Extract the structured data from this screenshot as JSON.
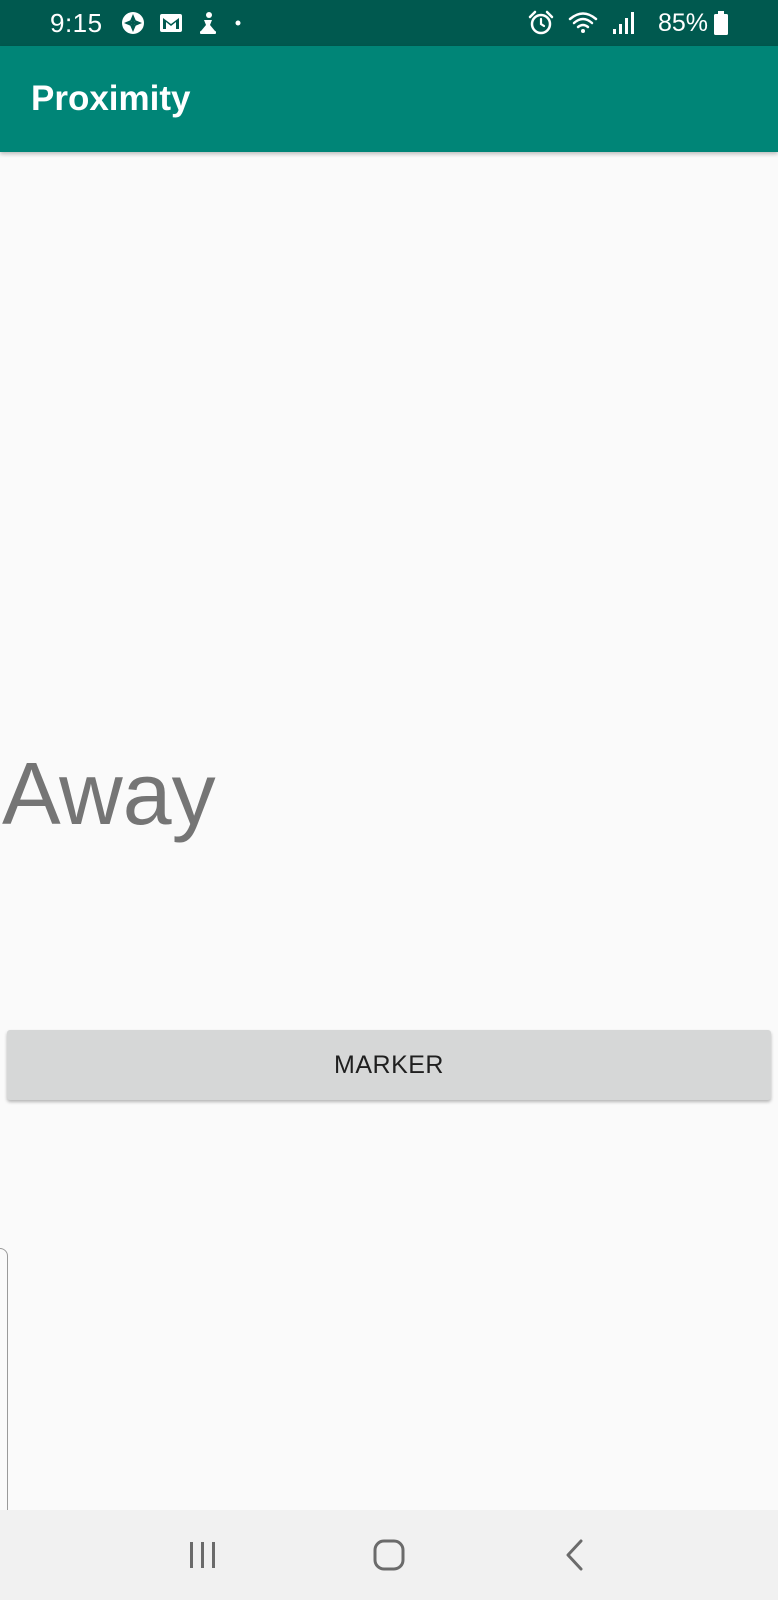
{
  "status_bar": {
    "time": "9:15",
    "battery_percent": "85%",
    "left_icons": [
      "aperture-icon",
      "gmail-icon",
      "notification-app-icon",
      "dot-icon"
    ],
    "right_icons": [
      "alarm-icon",
      "wifi-icon",
      "signal-icon",
      "battery-icon"
    ]
  },
  "app_bar": {
    "title": "Proximity"
  },
  "main": {
    "state_text": "Away",
    "marker_button_label": "MARKER"
  },
  "nav_bar": {
    "icons": [
      "recent-apps-icon",
      "home-icon",
      "back-icon"
    ]
  },
  "colors": {
    "status_bar_bg": "#00594f",
    "app_bar_bg": "#008577",
    "background": "#fafafa",
    "state_text": "#757575",
    "button_bg": "#d6d7d7",
    "nav_bar_bg": "#f1f1f1"
  }
}
